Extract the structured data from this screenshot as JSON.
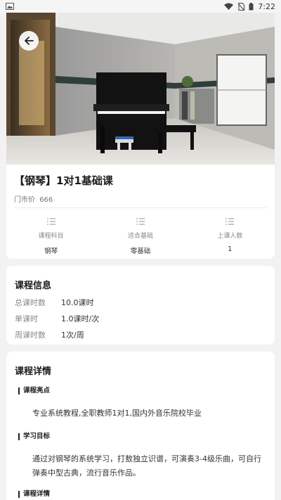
{
  "status_bar": {
    "time": "7:22"
  },
  "course": {
    "title": "【钢琴】1对1基础课",
    "price_label": "门市价",
    "price_value": "666"
  },
  "stats": [
    {
      "label": "课程科目",
      "value": "钢琴"
    },
    {
      "label": "适合基础",
      "value": "零基础"
    },
    {
      "label": "上课人数",
      "value": "1"
    }
  ],
  "course_info": {
    "title": "课程信息",
    "rows": [
      {
        "key": "总课时数",
        "value": "10.0课时"
      },
      {
        "key": "单课时",
        "value": "1.0课时/次"
      },
      {
        "key": "周课时数",
        "value": "1次/周"
      }
    ]
  },
  "course_detail": {
    "title": "课程详情",
    "highlights_heading": "课程亮点",
    "highlights_text": "专业系统教程,全职教师1对1,国内外音乐院校毕业",
    "goal_heading": "学习目标",
    "goal_text": "通过对钢琴的系统学习，打敖独立识谱，可演奏3-4级乐曲，可自行弹奏中型古典，流行音乐作品。",
    "details_heading": "课程详情"
  },
  "colors": {
    "background": "#f2f2f2",
    "card": "#ffffff"
  }
}
